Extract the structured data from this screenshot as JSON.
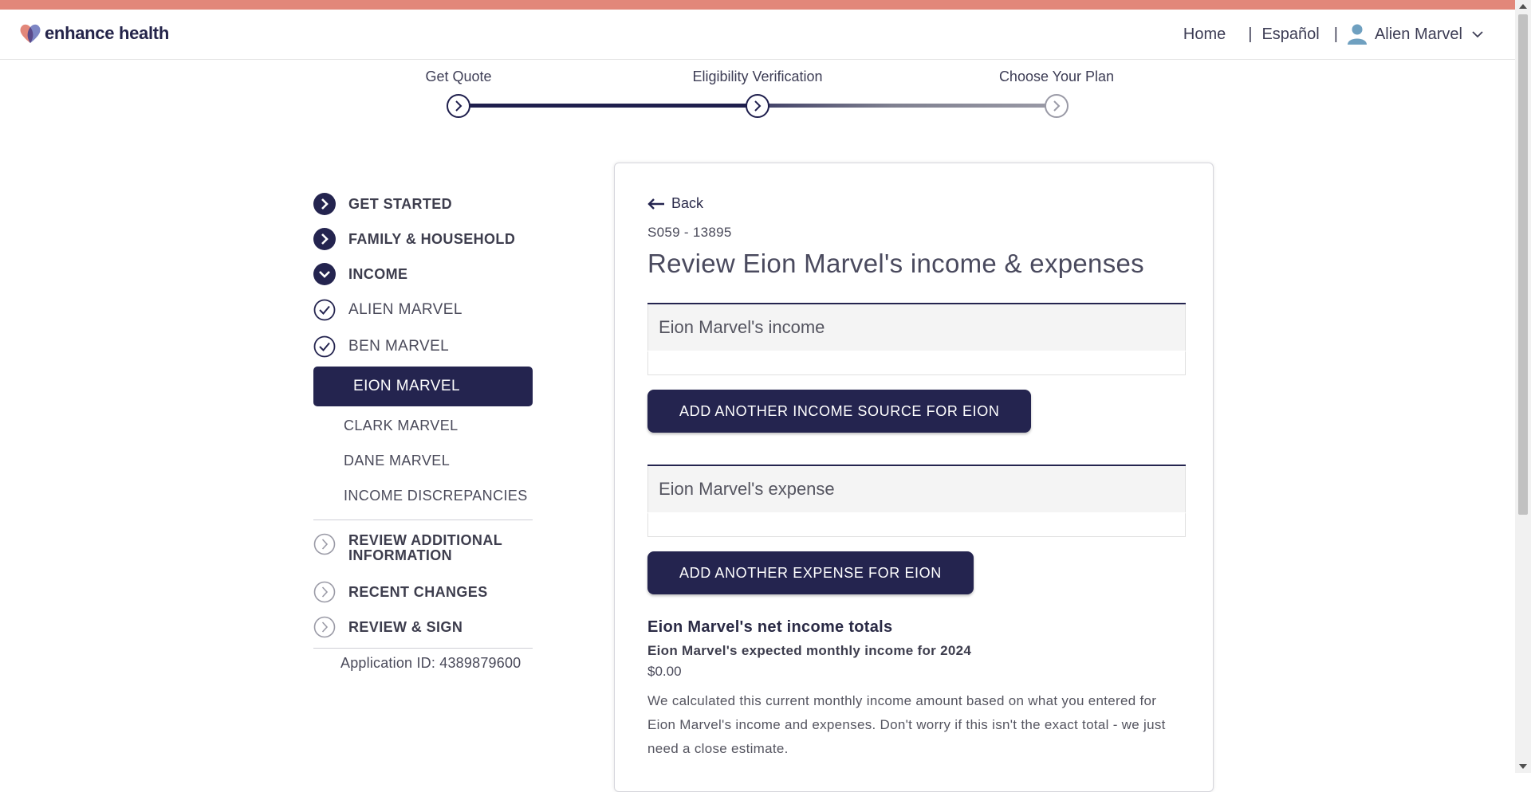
{
  "brand": {
    "name": "enhance health",
    "color_accent": "#e2877a",
    "color_primary": "#24244f"
  },
  "topnav": {
    "home": "Home",
    "language": "Español",
    "separator": "|",
    "user_name": "Alien Marvel"
  },
  "progress": {
    "steps": [
      {
        "label": "Get Quote",
        "state": "complete"
      },
      {
        "label": "Eligibility Verification",
        "state": "current"
      },
      {
        "label": "Choose Your Plan",
        "state": "upcoming"
      }
    ]
  },
  "sidebar": {
    "get_started": "GET STARTED",
    "family": "FAMILY & HOUSEHOLD",
    "income": "INCOME",
    "members": {
      "alien": "ALIEN MARVEL",
      "ben": "BEN MARVEL",
      "eion": "EION MARVEL",
      "clark": "CLARK MARVEL",
      "dane": "DANE MARVEL",
      "discrepancies": "INCOME DISCREPANCIES"
    },
    "review_additional_1": "REVIEW ADDITIONAL",
    "review_additional_2": "INFORMATION",
    "recent_changes": "RECENT CHANGES",
    "review_sign": "REVIEW & SIGN",
    "application_id": "Application ID: 4389879600"
  },
  "main": {
    "back": "Back",
    "case_id": "S059 - 13895",
    "title": "Review Eion Marvel's income & expenses",
    "income_panel_title": "Eion Marvel's income",
    "add_income_button": "ADD ANOTHER INCOME SOURCE FOR EION",
    "expense_panel_title": "Eion Marvel's expense",
    "add_expense_button": "ADD ANOTHER EXPENSE FOR EION",
    "totals_title": "Eion Marvel's net income totals",
    "totals_subtitle": "Eion Marvel's expected monthly income for 2024",
    "totals_amount": "$0.00",
    "totals_note": "We calculated this current monthly income amount based on what you entered for Eion Marvel's income and expenses. Don't worry if this isn't the exact total - we just need a close estimate."
  }
}
